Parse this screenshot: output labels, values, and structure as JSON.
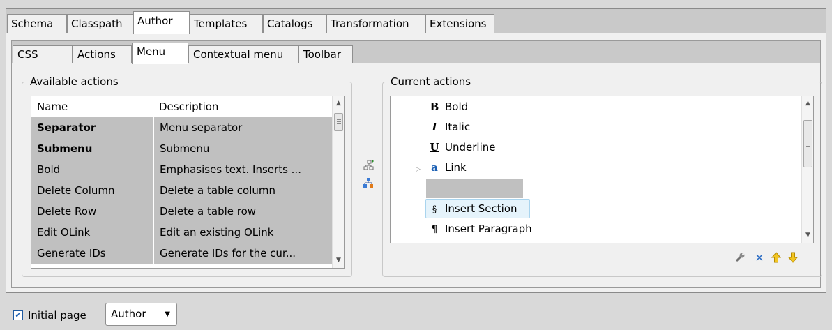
{
  "top_tabs": [
    {
      "label": "Schema"
    },
    {
      "label": "Classpath"
    },
    {
      "label": "Author",
      "active": true
    },
    {
      "label": "Templates"
    },
    {
      "label": "Catalogs"
    },
    {
      "label": "Transformation"
    },
    {
      "label": "Extensions"
    }
  ],
  "sub_tabs": [
    {
      "label": "CSS"
    },
    {
      "label": "Actions"
    },
    {
      "label": "Menu",
      "active": true
    },
    {
      "label": "Contextual menu"
    },
    {
      "label": "Toolbar"
    }
  ],
  "available": {
    "legend": "Available actions",
    "columns": [
      "Name",
      "Description"
    ],
    "rows": [
      {
        "name": "Separator",
        "description": "Menu separator",
        "bold": true
      },
      {
        "name": "Submenu",
        "description": "Submenu",
        "bold": true
      },
      {
        "name": "Bold",
        "description": "Emphasises text. Inserts ..."
      },
      {
        "name": "Delete Column",
        "description": "Delete a table column"
      },
      {
        "name": "Delete Row",
        "description": "Delete a table row"
      },
      {
        "name": "Edit OLink",
        "description": "Edit an existing OLink"
      },
      {
        "name": "Generate IDs",
        "description": "Generate IDs for the cur..."
      }
    ]
  },
  "current": {
    "legend": "Current actions",
    "items": [
      {
        "label": "Bold",
        "icon": "bold-icon",
        "glyph": "B"
      },
      {
        "label": "Italic",
        "icon": "italic-icon",
        "glyph": "I"
      },
      {
        "label": "Underline",
        "icon": "underline-icon",
        "glyph": "U"
      },
      {
        "label": "Link",
        "icon": "link-icon",
        "glyph": "a"
      },
      {
        "label": "",
        "icon": "separator",
        "glyph": ""
      },
      {
        "label": "Insert Section",
        "icon": "section-icon",
        "glyph": "§"
      },
      {
        "label": "Insert Paragraph",
        "icon": "paragraph-icon",
        "glyph": "¶"
      }
    ]
  },
  "footer": {
    "checkbox_label": "Initial page",
    "checkbox_checked": true,
    "select_value": "Author"
  }
}
